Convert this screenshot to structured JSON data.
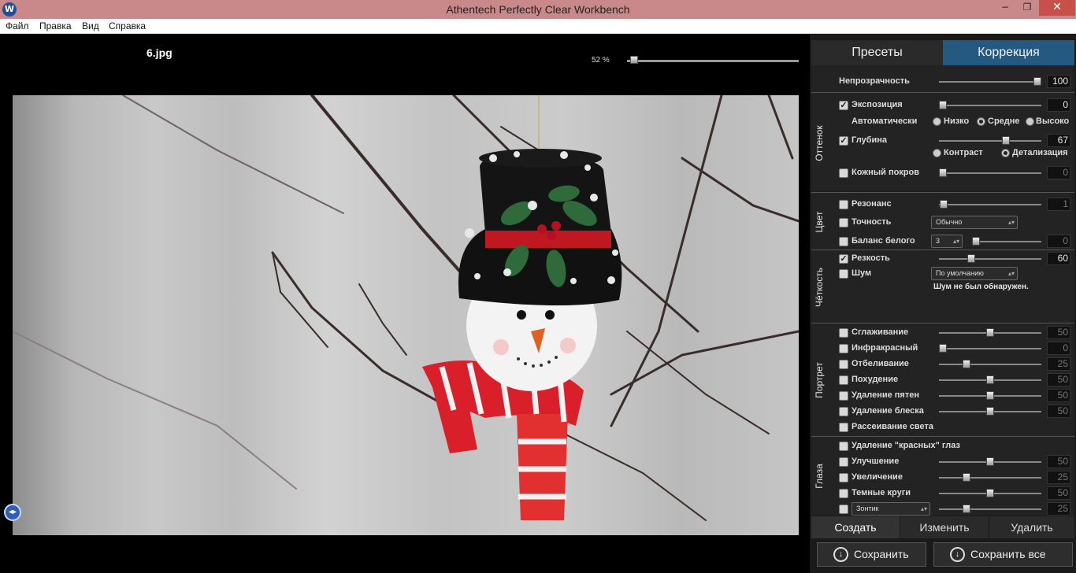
{
  "window": {
    "title": "Athentech Perfectly Clear Workbench",
    "app_icon": "W",
    "minimize": "−",
    "maximize": "❐",
    "close": "✕"
  },
  "menu": [
    "Файл",
    "Правка",
    "Вид",
    "Справка"
  ],
  "viewer": {
    "filename": "6.jpg",
    "zoom": "52 %",
    "zoom_fraction": 0.02,
    "compare_icon": "◂▸"
  },
  "tabs": {
    "presets": "Пресеты",
    "correction": "Коррекция"
  },
  "opacity": {
    "label": "Непрозрачность",
    "value": "100",
    "fraction": 1.0
  },
  "tone": {
    "group": "Оттенок",
    "exposure": {
      "label": "Экспозиция",
      "checked": "✓",
      "value": "0",
      "fraction": 0.0
    },
    "auto": {
      "label": "Автоматически",
      "low": "Низко",
      "mid": "Средне",
      "high": "Высоко"
    },
    "depth": {
      "label": "Глубина",
      "checked": "✓",
      "value": "67",
      "fraction": 0.67
    },
    "contrast": "Контраст",
    "detail": "Детализация",
    "skin": {
      "label": "Кожный покров",
      "value": "0",
      "fraction": 0.0
    }
  },
  "color": {
    "group": "Цвет",
    "vibrancy": {
      "label": "Резонанс",
      "value": "1",
      "fraction": 0.01
    },
    "accuracy": {
      "label": "Точность",
      "select": "Обычно"
    },
    "white_balance": {
      "label": "Баланс белого",
      "spin": "3",
      "value": "0",
      "fraction": 0.0
    }
  },
  "clarity": {
    "group": "Чёткость",
    "sharpness": {
      "label": "Резкость",
      "checked": "✓",
      "value": "60",
      "fraction": 0.3
    },
    "noise": {
      "label": "Шум",
      "select": "По умолчанию"
    },
    "noise_msg": "Шум не был обнаружен."
  },
  "portrait": {
    "group": "Портрет",
    "rows": [
      {
        "label": "Сглаживание",
        "value": "50",
        "fraction": 0.5
      },
      {
        "label": "Инфракрасный",
        "value": "0",
        "fraction": 0.0
      },
      {
        "label": "Отбеливание",
        "value": "25",
        "fraction": 0.25
      },
      {
        "label": "Похудение",
        "value": "50",
        "fraction": 0.5
      },
      {
        "label": "Удаление пятен",
        "value": "50",
        "fraction": 0.5
      },
      {
        "label": "Удаление блеска",
        "value": "50",
        "fraction": 0.5
      }
    ],
    "light_diffusion": "Рассеивание света"
  },
  "eyes": {
    "group": "Глаза",
    "red_eye": "Удаление \"красных\" глаз",
    "rows": [
      {
        "label": "Улучшение",
        "value": "50",
        "fraction": 0.5
      },
      {
        "label": "Увеличение",
        "value": "25",
        "fraction": 0.25
      },
      {
        "label": "Темные круги",
        "value": "50",
        "fraction": 0.5
      }
    ],
    "last": {
      "select": "Зонтик",
      "value": "25",
      "fraction": 0.25
    }
  },
  "actions": {
    "create": "Создать",
    "edit": "Изменить",
    "delete": "Удалить"
  },
  "save": {
    "save": "Сохранить",
    "save_all": "Сохранить все",
    "icon": "↓"
  }
}
